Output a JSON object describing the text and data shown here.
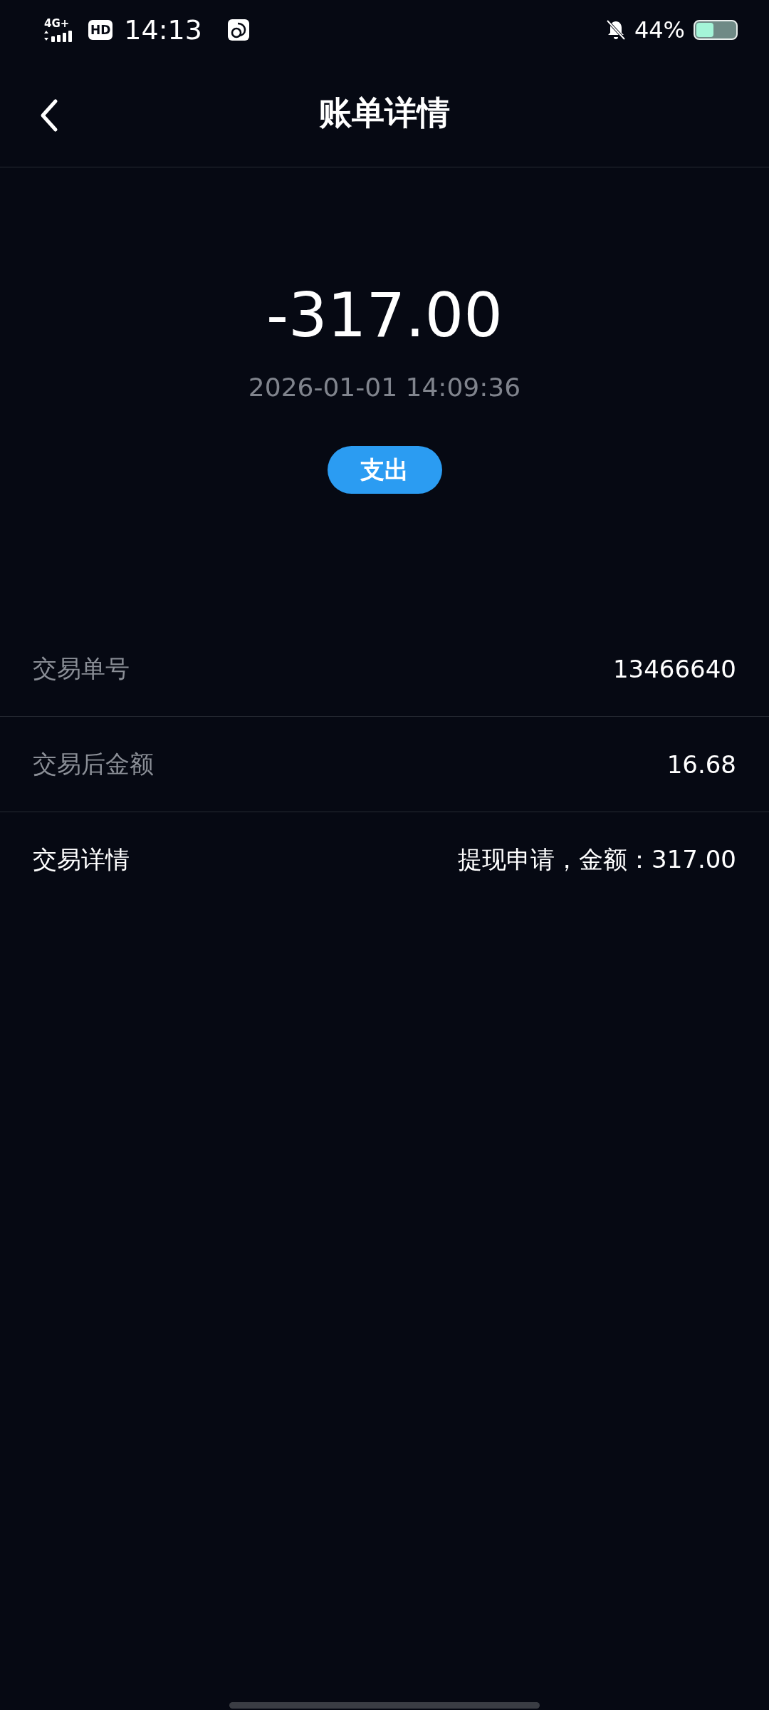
{
  "status_bar": {
    "network": "4G+",
    "hd": "HD",
    "time": "14:13",
    "battery_text": "44%"
  },
  "header": {
    "title": "账单详情"
  },
  "summary": {
    "amount": "-317.00",
    "datetime": "2026-01-01 14:09:36",
    "type_badge": "支出"
  },
  "details": [
    {
      "label": "交易单号",
      "value": "13466640",
      "emphasized": false
    },
    {
      "label": "交易后金额",
      "value": "16.68",
      "emphasized": false
    },
    {
      "label": "交易详情",
      "value": "提现申请，金额：317.00",
      "emphasized": true
    }
  ]
}
